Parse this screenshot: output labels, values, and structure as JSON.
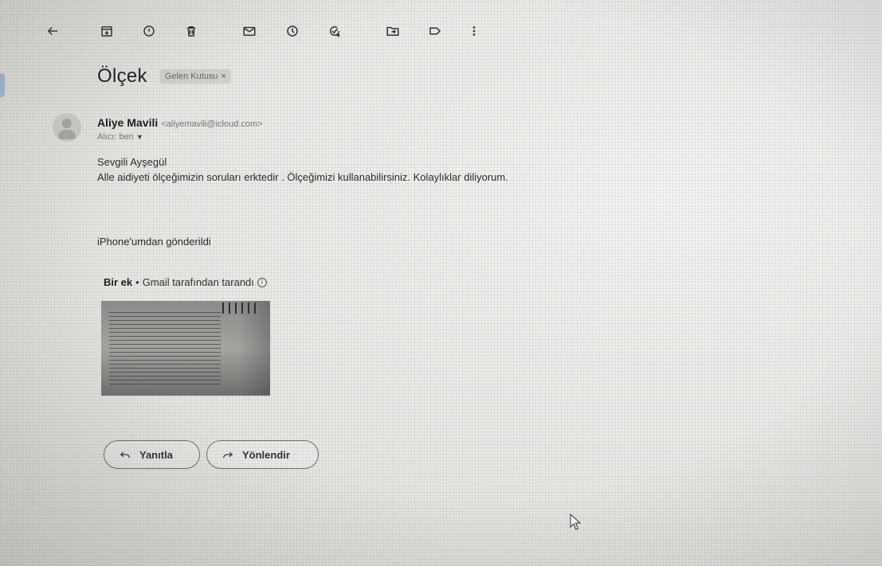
{
  "toolbar": {
    "icons": [
      "back-arrow-icon",
      "archive-icon",
      "report-spam-icon",
      "delete-icon",
      "mark-unread-icon",
      "snooze-icon",
      "add-to-tasks-icon",
      "move-to-icon",
      "label-icon",
      "more-options-icon"
    ]
  },
  "email": {
    "subject": "Ölçek",
    "label": "Gelen Kutusu",
    "label_close": "×",
    "sender_name": "Aliye Mavili",
    "sender_email": "<aliyemavili@icloud.com>",
    "recipient": "Alıcı: ben",
    "greeting": "Sevgili Ayşegül",
    "body_line": "Alle aidiyeti ölçeğimizin soruları erktedir . Ölçeğimizi kullanabilirsiniz. Kolaylıklar diliyorum.",
    "signature": "iPhone'umdan gönderildi"
  },
  "attachments": {
    "count_label": "Bir ek",
    "separator": "•",
    "scan_note": "Gmail tarafından tarandı",
    "info_glyph": "i"
  },
  "actions": {
    "reply_label": "Yanıtla",
    "forward_label": "Yönlendir"
  }
}
